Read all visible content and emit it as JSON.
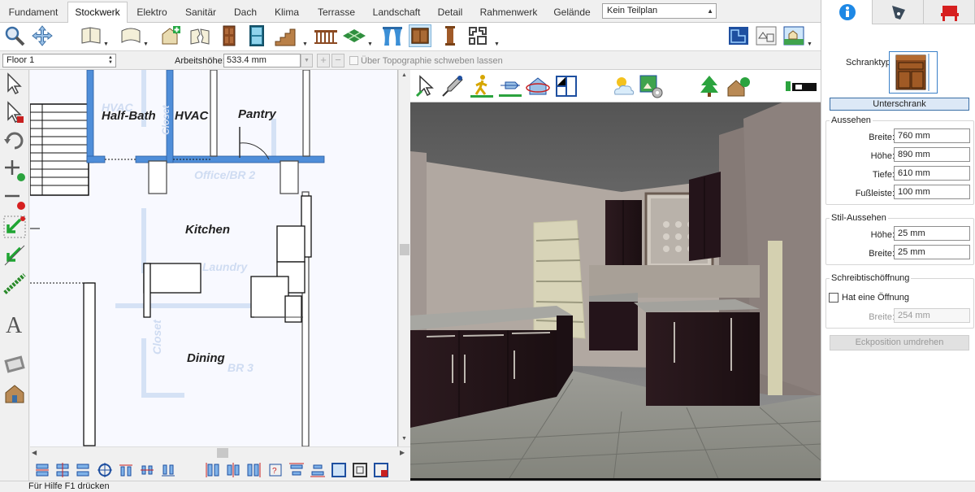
{
  "ribbon": {
    "tabs": [
      {
        "label": "Fundament",
        "active": false
      },
      {
        "label": "Stockwerk",
        "active": true
      },
      {
        "label": "Elektro",
        "active": false
      },
      {
        "label": "Sanitär",
        "active": false
      },
      {
        "label": "Dach",
        "active": false
      },
      {
        "label": "Klima",
        "active": false
      },
      {
        "label": "Terrasse",
        "active": false
      },
      {
        "label": "Landschaft",
        "active": false
      },
      {
        "label": "Detail",
        "active": false
      },
      {
        "label": "Rahmenwerk",
        "active": false
      },
      {
        "label": "Gelände",
        "active": false
      }
    ],
    "plan_select": "Kein Teilplan"
  },
  "toolbar": {
    "tools": [
      "zoom-icon",
      "pan-icon",
      "wall-icon",
      "roof-icon",
      "add-room-icon",
      "break-wall-icon",
      "door-icon",
      "window-icon",
      "stairs-icon",
      "railing-icon",
      "floor-tile-icon",
      "curtain-icon",
      "cabinet-icon",
      "column-icon",
      "decor-icon"
    ],
    "selected_tool": "cabinet-icon",
    "view_tools": [
      "floor-plan-view-icon",
      "elevation-view-icon",
      "3d-view-icon"
    ]
  },
  "options": {
    "floor": "Floor 1",
    "height_label": "Arbeitshöhe:",
    "height_value": "533.4 mm",
    "topography_label": "Über Topographie schweben lassen",
    "topography_checked": false
  },
  "plan": {
    "rooms": [
      "Half-Bath",
      "HVAC",
      "Pantry",
      "Kitchen",
      "Dining"
    ],
    "ghost_rooms": [
      "HVAC",
      "Office/BR 2",
      "Laundry",
      "BR 3",
      "Closet",
      "Closet"
    ]
  },
  "view3d_tools": [
    "select-3d-icon",
    "eyedropper-icon",
    "walk-icon",
    "fly-icon",
    "orbit-icon",
    "camera-icon",
    "sky-icon",
    "render-settings-icon",
    "landscape-icon",
    "house-icon",
    "light-toggle-icon"
  ],
  "status": {
    "text": "Für Hilfe F1 drücken"
  },
  "panel": {
    "tabs": [
      "info-icon",
      "pen-icon",
      "furniture-icon"
    ],
    "schranktyp_label": "Schranktyp",
    "schranktyp_value": "Unterschrank",
    "aussehen": {
      "title": "Aussehen",
      "fields": [
        {
          "label": "Breite:",
          "value": "760 mm"
        },
        {
          "label": "Höhe:",
          "value": "890 mm"
        },
        {
          "label": "Tiefe:",
          "value": "610 mm"
        },
        {
          "label": "Fußleiste:",
          "value": "100 mm"
        }
      ]
    },
    "stil": {
      "title": "Stil-Aussehen",
      "fields": [
        {
          "label": "Höhe:",
          "value": "25 mm"
        },
        {
          "label": "Breite:",
          "value": "25 mm"
        }
      ]
    },
    "schreibtisch": {
      "title": "Schreibtischöffnung",
      "checkbox_label": "Hat eine Öffnung",
      "checked": false,
      "width_label": "Breite:",
      "width_value": "254 mm"
    },
    "flip_button": "Eckposition umdrehen"
  },
  "colors": {
    "accent": "#1e88e5",
    "wall_blue": "#4f8ed9",
    "cabinet": "#2a1a1e",
    "counter": "#9a9a96"
  }
}
